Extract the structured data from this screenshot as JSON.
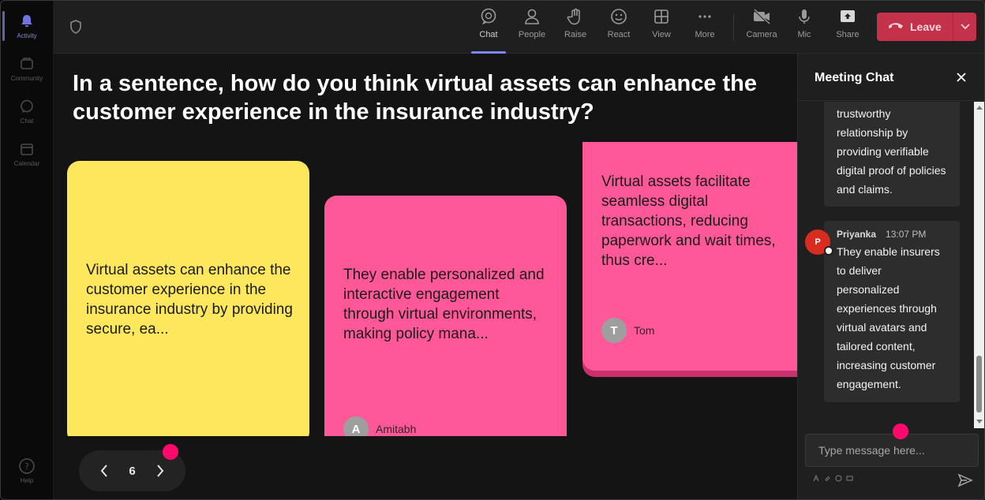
{
  "rail": {
    "items": [
      {
        "label": "Activity",
        "icon": "bell-icon"
      },
      {
        "label": "Community",
        "icon": "community-icon"
      },
      {
        "label": "Chat",
        "icon": "chat-icon"
      },
      {
        "label": "Calendar",
        "icon": "calendar-icon"
      },
      {
        "label": "Help",
        "icon": "help-icon"
      }
    ]
  },
  "toolbar": {
    "buttons": [
      {
        "label": "Chat",
        "icon": "chat-icon"
      },
      {
        "label": "People",
        "icon": "people-icon"
      },
      {
        "label": "Raise",
        "icon": "hand-icon"
      },
      {
        "label": "React",
        "icon": "smiley-icon"
      },
      {
        "label": "View",
        "icon": "grid-icon"
      },
      {
        "label": "More",
        "icon": "ellipsis-icon"
      },
      {
        "label": "Camera",
        "icon": "camera-off-icon"
      },
      {
        "label": "Mic",
        "icon": "mic-icon"
      },
      {
        "label": "Share",
        "icon": "share-icon"
      }
    ],
    "leave_label": "Leave"
  },
  "stage": {
    "question": "In a sentence, how do you think virtual assets can enhance the customer experience in the insurance industry?",
    "cards": [
      {
        "text": "Virtual assets can enhance the customer experience in the insurance industry by providing secure, ea...",
        "author": "",
        "initial": "",
        "color": "#fde75c"
      },
      {
        "text": "They enable personalized and interactive engagement through virtual environments, making policy mana...",
        "author": "Amitabh",
        "initial": "A",
        "color": "#ff5899"
      },
      {
        "text": "Virtual assets facilitate seamless digital transactions, reducing paperwork and wait times, thus cre...",
        "author": "Tom",
        "initial": "T",
        "color": "#ff5899"
      }
    ],
    "page": "6"
  },
  "chat": {
    "title": "Meeting Chat",
    "messages": [
      {
        "sender": "",
        "time": "",
        "text": "trustworthy relationship by providing verifiable digital proof of policies and claims."
      },
      {
        "sender": "Priyanka",
        "time": "13:07 PM",
        "initial": "P",
        "text": "They enable insurers to deliver personalized experiences through virtual avatars and tailored content, increasing customer engagement."
      }
    ],
    "input_placeholder": "Type message here..."
  },
  "colors": {
    "accent": "#7f85f5",
    "leave": "#c4314b",
    "note_yellow": "#fde75c",
    "note_pink": "#ff5899",
    "indicator": "#ff0a6c"
  }
}
